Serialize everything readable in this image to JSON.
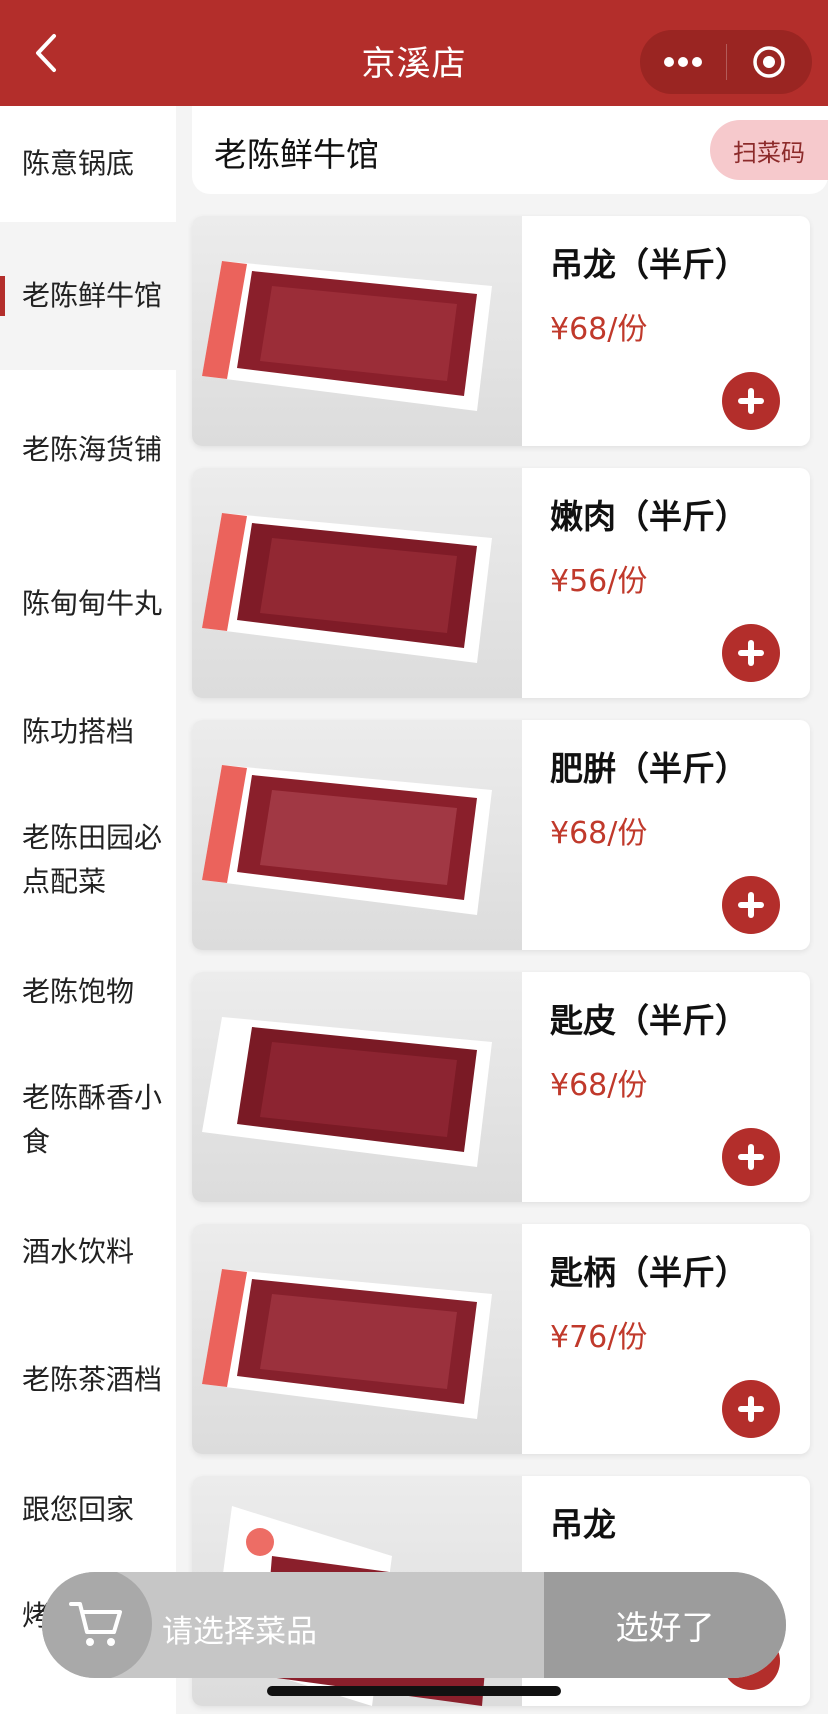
{
  "header": {
    "title": "京溪店"
  },
  "sidebar": {
    "items": [
      {
        "label": "陈意锅底",
        "active": false
      },
      {
        "label": "老陈鲜牛馆",
        "active": true
      },
      {
        "label": "老陈海货铺",
        "active": false
      },
      {
        "label": "陈甸甸牛丸",
        "active": false
      },
      {
        "label": "陈功搭档",
        "active": false
      },
      {
        "label": "老陈田园必点配菜",
        "active": false
      },
      {
        "label": "老陈饱物",
        "active": false
      },
      {
        "label": "老陈酥香小食",
        "active": false
      },
      {
        "label": "酒水饮料",
        "active": false
      },
      {
        "label": "老陈茶酒档",
        "active": false
      },
      {
        "label": "跟您回家",
        "active": false
      }
    ],
    "partial_item": "烤"
  },
  "section": {
    "title": "老陈鲜牛馆",
    "scan_label": "扫菜码"
  },
  "products": [
    {
      "name": "吊龙（半斤）",
      "price": "¥68/份"
    },
    {
      "name": "嫩肉（半斤）",
      "price": "¥56/份"
    },
    {
      "name": "肥腁（半斤）",
      "price": "¥68/份"
    },
    {
      "name": "匙皮（半斤）",
      "price": "¥68/份"
    },
    {
      "name": "匙柄（半斤）",
      "price": "¥76/份"
    },
    {
      "name": "吊龙",
      "price": ""
    }
  ],
  "cart": {
    "hint": "请选择菜品",
    "confirm_label": "选好了"
  },
  "colors": {
    "brand": "#b32e2b",
    "price": "#c0392b",
    "scan_bg": "#f6c9cc"
  },
  "icons": [
    "back-icon",
    "more-icon",
    "target-icon",
    "plus-icon",
    "cart-icon"
  ]
}
